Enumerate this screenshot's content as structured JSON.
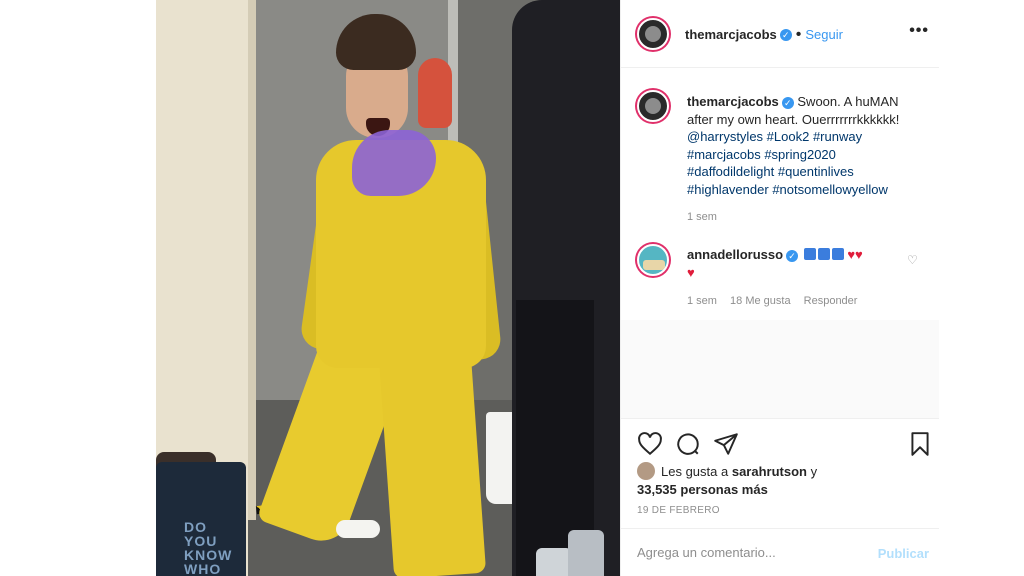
{
  "header": {
    "username": "themarcjacobs",
    "follow_label": "Seguir",
    "more_label": "•••"
  },
  "caption": {
    "username": "themarcjacobs",
    "text": "Swoon. A huMAN after my own heart. Ouerrrrrrrkkkkkk!",
    "tags": [
      "@harrystyles",
      "#Look2",
      "#runway",
      "#marcjacobs",
      "#spring2020",
      "#daffodildelight",
      "#quentinlives",
      "#highlavender",
      "#notsomellowyellow"
    ],
    "time": "1 sem"
  },
  "comment": {
    "username": "annadellorusso",
    "time": "1 sem",
    "likes": "18 Me gusta",
    "reply_label": "Responder"
  },
  "likes": {
    "prefix": "Les gusta a",
    "user": "sarahrutson",
    "joiner": "y",
    "count_text": "33,535 personas más"
  },
  "date": "19 DE FEBRERO",
  "add_comment": {
    "placeholder": "Agrega un comentario...",
    "publish_label": "Publicar"
  },
  "photo": {
    "bag_text": "DO YOU KNOW WHO"
  },
  "icons": [
    "heart-icon",
    "comment-icon",
    "share-icon",
    "bookmark-icon",
    "verified-icon",
    "more-icon"
  ],
  "colors": {
    "accent": "#3897f0",
    "heart": "#e01d3b",
    "ring": "#e0306a"
  }
}
